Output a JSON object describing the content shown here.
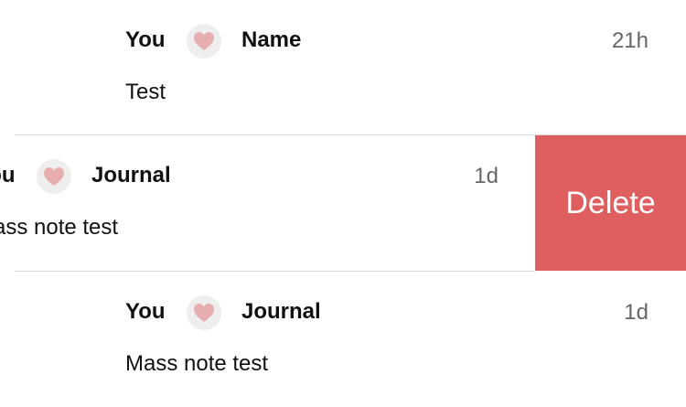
{
  "notes": [
    {
      "sender": "You",
      "recipient": "Name",
      "time": "21h",
      "text": "Test"
    },
    {
      "sender": "You",
      "recipient": "Journal",
      "time": "1d",
      "text": "Mass note test"
    },
    {
      "sender": "You",
      "recipient": "Journal",
      "time": "1d",
      "text": "Mass note test"
    }
  ],
  "swipe_action": {
    "label": "Delete",
    "color": "#DF5E5F"
  },
  "colors": {
    "heart": "#E7AEB0",
    "heart_bg": "#EEEEEE",
    "divider": "#D9D9D9"
  }
}
